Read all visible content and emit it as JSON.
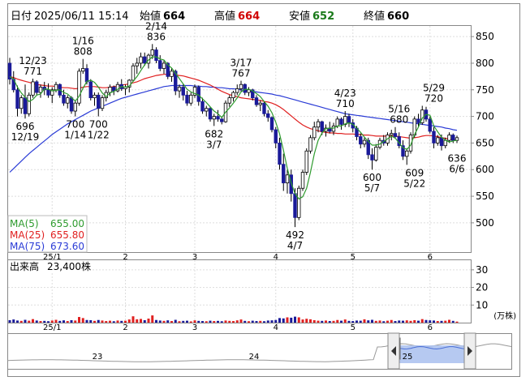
{
  "header": {
    "date_label": "日付",
    "datetime": "2025/06/11 15:14",
    "open_label": "始値",
    "open_value": "664",
    "high_label": "高値",
    "high_value": "664",
    "low_label": "安値",
    "low_value": "652",
    "close_label": "終値",
    "close_value": "660"
  },
  "legend": {
    "ma5_label": "MA(5)",
    "ma5_value": "655.00",
    "ma25_label": "MA(25)",
    "ma25_value": "655.80",
    "ma75_label": "MA(75)",
    "ma75_value": "673.60"
  },
  "volume_header": {
    "label": "出来高",
    "value": "23,400株"
  },
  "volume_unit": "(万株)",
  "colors": {
    "up": "#e02020",
    "down": "#1a1a99",
    "ma5": "#2e9b2e",
    "ma25": "#e02020",
    "ma75": "#2a3bd6",
    "high_value": "#d00000",
    "low_value": "#1a7a1a",
    "nav_fill": "#a9c0ee"
  },
  "nav": {
    "labels": [
      "23",
      "24",
      "25"
    ]
  },
  "chart_data": {
    "type": "candlestick",
    "ylim": [
      445,
      870
    ],
    "yticks": [
      500,
      550,
      600,
      650,
      700,
      750,
      800,
      850
    ],
    "xtick_labels": [
      "25/1",
      "2",
      "3",
      "4",
      "5",
      "6"
    ],
    "xtick_index": [
      11,
      30,
      48,
      69,
      89,
      109
    ],
    "annotations": [
      {
        "i": 6,
        "text": [
          "12/23",
          "771"
        ],
        "value": 771,
        "pos": "above"
      },
      {
        "i": 4,
        "text": [
          "696",
          "12/19"
        ],
        "value": 696,
        "pos": "below"
      },
      {
        "i": 19,
        "text": [
          "1/16",
          "808"
        ],
        "value": 808,
        "pos": "above"
      },
      {
        "i": 17,
        "text": [
          "700",
          "1/14"
        ],
        "value": 700,
        "pos": "below"
      },
      {
        "i": 23,
        "text": [
          "700",
          "1/22"
        ],
        "value": 700,
        "pos": "below"
      },
      {
        "i": 38,
        "text": [
          "2/14",
          "836"
        ],
        "value": 836,
        "pos": "above"
      },
      {
        "i": 53,
        "text": [
          "682",
          "3/7"
        ],
        "value": 682,
        "pos": "below"
      },
      {
        "i": 60,
        "text": [
          "3/17",
          "767"
        ],
        "value": 767,
        "pos": "above"
      },
      {
        "i": 74,
        "text": [
          "492",
          "4/7"
        ],
        "value": 492,
        "pos": "below"
      },
      {
        "i": 87,
        "text": [
          "4/23",
          "710"
        ],
        "value": 710,
        "pos": "above"
      },
      {
        "i": 94,
        "text": [
          "600",
          "5/7"
        ],
        "value": 600,
        "pos": "below"
      },
      {
        "i": 101,
        "text": [
          "5/16",
          "680"
        ],
        "value": 680,
        "pos": "above"
      },
      {
        "i": 105,
        "text": [
          "609",
          "5/22"
        ],
        "value": 609,
        "pos": "below"
      },
      {
        "i": 110,
        "text": [
          "5/29",
          "720"
        ],
        "value": 720,
        "pos": "above"
      },
      {
        "i": 116,
        "text": [
          "636",
          "6/6"
        ],
        "value": 636,
        "pos": "below"
      }
    ],
    "candles": [
      [
        800,
        810,
        760,
        770
      ],
      [
        770,
        785,
        745,
        750
      ],
      [
        750,
        758,
        700,
        715
      ],
      [
        715,
        740,
        705,
        735
      ],
      [
        735,
        760,
        696,
        705
      ],
      [
        705,
        745,
        700,
        740
      ],
      [
        740,
        771,
        735,
        765
      ],
      [
        765,
        768,
        740,
        745
      ],
      [
        745,
        760,
        735,
        755
      ],
      [
        755,
        765,
        740,
        750
      ],
      [
        750,
        762,
        735,
        740
      ],
      [
        740,
        755,
        725,
        750
      ],
      [
        750,
        765,
        745,
        760
      ],
      [
        760,
        762,
        735,
        740
      ],
      [
        740,
        750,
        720,
        725
      ],
      [
        725,
        740,
        715,
        735
      ],
      [
        735,
        738,
        705,
        710
      ],
      [
        710,
        730,
        700,
        725
      ],
      [
        725,
        790,
        720,
        785
      ],
      [
        785,
        808,
        780,
        790
      ],
      [
        790,
        798,
        760,
        765
      ],
      [
        765,
        770,
        730,
        735
      ],
      [
        735,
        745,
        720,
        740
      ],
      [
        740,
        745,
        700,
        715
      ],
      [
        715,
        740,
        710,
        735
      ],
      [
        735,
        750,
        728,
        745
      ],
      [
        745,
        760,
        738,
        755
      ],
      [
        755,
        758,
        740,
        748
      ],
      [
        748,
        765,
        745,
        760
      ],
      [
        760,
        770,
        748,
        752
      ],
      [
        752,
        760,
        740,
        755
      ],
      [
        755,
        770,
        745,
        768
      ],
      [
        768,
        800,
        765,
        795
      ],
      [
        795,
        810,
        780,
        800
      ],
      [
        800,
        820,
        790,
        812
      ],
      [
        812,
        820,
        795,
        800
      ],
      [
        800,
        818,
        790,
        815
      ],
      [
        815,
        836,
        808,
        825
      ],
      [
        825,
        830,
        800,
        805
      ],
      [
        805,
        815,
        785,
        790
      ],
      [
        790,
        805,
        780,
        800
      ],
      [
        800,
        802,
        770,
        775
      ],
      [
        775,
        790,
        765,
        785
      ],
      [
        785,
        788,
        740,
        748
      ],
      [
        748,
        760,
        735,
        755
      ],
      [
        755,
        760,
        730,
        740
      ],
      [
        740,
        748,
        720,
        725
      ],
      [
        725,
        745,
        720,
        740
      ],
      [
        740,
        760,
        735,
        755
      ],
      [
        755,
        758,
        720,
        728
      ],
      [
        728,
        735,
        705,
        710
      ],
      [
        710,
        720,
        700,
        715
      ],
      [
        715,
        718,
        690,
        695
      ],
      [
        695,
        705,
        682,
        700
      ],
      [
        700,
        712,
        690,
        695
      ],
      [
        695,
        700,
        685,
        690
      ],
      [
        690,
        730,
        688,
        725
      ],
      [
        725,
        740,
        718,
        735
      ],
      [
        735,
        748,
        728,
        745
      ],
      [
        745,
        760,
        740,
        752
      ],
      [
        752,
        767,
        745,
        760
      ],
      [
        760,
        762,
        740,
        745
      ],
      [
        745,
        755,
        738,
        750
      ],
      [
        750,
        752,
        730,
        735
      ],
      [
        735,
        740,
        718,
        722
      ],
      [
        722,
        730,
        710,
        725
      ],
      [
        725,
        728,
        700,
        705
      ],
      [
        705,
        712,
        690,
        698
      ],
      [
        698,
        700,
        670,
        675
      ],
      [
        675,
        680,
        640,
        650
      ],
      [
        650,
        660,
        600,
        610
      ],
      [
        610,
        630,
        560,
        575
      ],
      [
        575,
        600,
        555,
        590
      ],
      [
        590,
        600,
        540,
        555
      ],
      [
        555,
        565,
        492,
        510
      ],
      [
        510,
        570,
        505,
        565
      ],
      [
        565,
        600,
        560,
        595
      ],
      [
        595,
        640,
        590,
        635
      ],
      [
        635,
        665,
        630,
        660
      ],
      [
        660,
        690,
        655,
        680
      ],
      [
        680,
        695,
        670,
        690
      ],
      [
        690,
        692,
        665,
        672
      ],
      [
        672,
        685,
        662,
        678
      ],
      [
        678,
        690,
        668,
        672
      ],
      [
        672,
        688,
        665,
        682
      ],
      [
        682,
        700,
        678,
        695
      ],
      [
        695,
        698,
        675,
        685
      ],
      [
        685,
        710,
        680,
        700
      ],
      [
        700,
        705,
        680,
        688
      ],
      [
        688,
        695,
        670,
        678
      ],
      [
        678,
        682,
        655,
        662
      ],
      [
        662,
        668,
        640,
        648
      ],
      [
        648,
        660,
        642,
        655
      ],
      [
        655,
        660,
        620,
        628
      ],
      [
        628,
        640,
        600,
        618
      ],
      [
        618,
        648,
        615,
        642
      ],
      [
        642,
        660,
        638,
        655
      ],
      [
        655,
        665,
        645,
        650
      ],
      [
        650,
        670,
        645,
        665
      ],
      [
        665,
        675,
        655,
        668
      ],
      [
        668,
        680,
        658,
        662
      ],
      [
        662,
        670,
        640,
        645
      ],
      [
        645,
        655,
        618,
        625
      ],
      [
        625,
        640,
        609,
        635
      ],
      [
        635,
        670,
        630,
        665
      ],
      [
        665,
        700,
        660,
        695
      ],
      [
        695,
        705,
        680,
        688
      ],
      [
        688,
        720,
        684,
        712
      ],
      [
        712,
        718,
        690,
        695
      ],
      [
        695,
        700,
        668,
        672
      ],
      [
        672,
        680,
        640,
        650
      ],
      [
        650,
        665,
        645,
        660
      ],
      [
        660,
        666,
        636,
        645
      ],
      [
        645,
        660,
        640,
        655
      ],
      [
        655,
        670,
        650,
        665
      ],
      [
        665,
        668,
        650,
        655
      ],
      [
        655,
        664,
        650,
        660
      ]
    ],
    "ma5": [
      775,
      770,
      755,
      744,
      736,
      728,
      732,
      740,
      742,
      752,
      751,
      748,
      749,
      750,
      745,
      742,
      735,
      729,
      738,
      753,
      766,
      768,
      764,
      755,
      744,
      737,
      744,
      747,
      751,
      756,
      755,
      757,
      766,
      775,
      786,
      797,
      806,
      812,
      812,
      808,
      806,
      797,
      791,
      781,
      771,
      761,
      751,
      746,
      743,
      740,
      733,
      726,
      718,
      710,
      705,
      698,
      708,
      716,
      725,
      735,
      746,
      751,
      751,
      748,
      743,
      737,
      728,
      719,
      707,
      689,
      667,
      636,
      602,
      575,
      555,
      545,
      549,
      565,
      595,
      630,
      655,
      669,
      677,
      678,
      678,
      682,
      682,
      686,
      688,
      685,
      678,
      670,
      661,
      653,
      646,
      646,
      648,
      653,
      658,
      663,
      659,
      650,
      641,
      638,
      646,
      666,
      680,
      697,
      704,
      702,
      682,
      671,
      661,
      655,
      652,
      654,
      655
    ],
    "ma25": [
      775,
      773,
      770,
      768,
      766,
      764,
      762,
      760,
      759,
      758,
      757,
      757,
      756,
      755,
      754,
      754,
      753,
      752,
      753,
      755,
      756,
      756,
      756,
      755,
      754,
      754,
      755,
      756,
      757,
      759,
      760,
      761,
      763,
      765,
      768,
      771,
      773,
      775,
      777,
      778,
      779,
      779,
      779,
      778,
      777,
      776,
      774,
      772,
      770,
      768,
      765,
      762,
      759,
      755,
      751,
      747,
      744,
      741,
      739,
      737,
      735,
      734,
      733,
      732,
      731,
      730,
      728,
      727,
      725,
      722,
      718,
      713,
      707,
      701,
      695,
      689,
      684,
      680,
      677,
      675,
      673,
      671,
      670,
      669,
      669,
      668,
      668,
      667,
      667,
      667,
      666,
      666,
      665,
      665,
      664,
      663,
      663,
      663,
      663,
      663,
      663,
      662,
      661,
      660,
      659,
      660,
      661,
      663,
      664,
      664,
      663,
      662,
      660,
      659,
      657,
      656,
      656
    ],
    "ma75": [
      595,
      602,
      609,
      616,
      623,
      630,
      636,
      642,
      648,
      654,
      660,
      666,
      671,
      676,
      681,
      686,
      690,
      694,
      698,
      702,
      706,
      710,
      713,
      716,
      719,
      722,
      725,
      728,
      731,
      734,
      736,
      738,
      740,
      742,
      744,
      746,
      748,
      750,
      752,
      754,
      756,
      757,
      758,
      758,
      758,
      758,
      758,
      758,
      757,
      757,
      756,
      756,
      755,
      755,
      754,
      754,
      753,
      752,
      752,
      751,
      750,
      749,
      748,
      747,
      746,
      745,
      744,
      743,
      742,
      740,
      739,
      737,
      735,
      733,
      731,
      729,
      727,
      725,
      723,
      721,
      719,
      717,
      715,
      713,
      711,
      709,
      707,
      705,
      704,
      703,
      702,
      701,
      700,
      699,
      698,
      697,
      696,
      695,
      694,
      693,
      692,
      691,
      690,
      689,
      688,
      687,
      686,
      685,
      684,
      683,
      682,
      681,
      680,
      678,
      677,
      675,
      674
    ],
    "volume": [
      1.4,
      1.8,
      1.2,
      1.0,
      1.6,
      1.1,
      2.0,
      1.2,
      0.9,
      1.0,
      0.8,
      1.2,
      1.6,
      1.0,
      1.3,
      0.9,
      1.4,
      1.2,
      3.2,
      2.6,
      1.5,
      1.4,
      1.0,
      1.5,
      1.2,
      0.9,
      1.1,
      0.8,
      1.2,
      1.0,
      1.1,
      1.8,
      3.6,
      1.9,
      2.1,
      1.4,
      2.3,
      4.1,
      1.5,
      1.2,
      1.0,
      1.3,
      0.9,
      1.6,
      0.8,
      1.0,
      1.1,
      0.7,
      1.3,
      1.0,
      0.9,
      0.8,
      1.1,
      0.9,
      1.0,
      0.8,
      1.2,
      1.0,
      0.9,
      1.3,
      1.8,
      1.0,
      0.8,
      1.1,
      0.9,
      1.0,
      0.8,
      1.2,
      1.3,
      1.5,
      2.6,
      2.4,
      3.0,
      2.8,
      3.4,
      3.0,
      1.8,
      2.2,
      1.9,
      1.4,
      1.1,
      1.0,
      1.2,
      0.9,
      1.0,
      1.5,
      1.1,
      1.8,
      1.0,
      0.9,
      1.2,
      1.1,
      1.9,
      1.3,
      1.6,
      1.0,
      1.2,
      0.8,
      1.1,
      1.5,
      0.9,
      1.2,
      1.1,
      1.3,
      1.0,
      1.4,
      1.1,
      2.0,
      1.5,
      1.3,
      1.2,
      0.9,
      1.0,
      1.1,
      1.6,
      1.0,
      0.6
    ],
    "volume_ylim": [
      0,
      35
    ],
    "volume_ticks": [
      10,
      20,
      30
    ]
  }
}
